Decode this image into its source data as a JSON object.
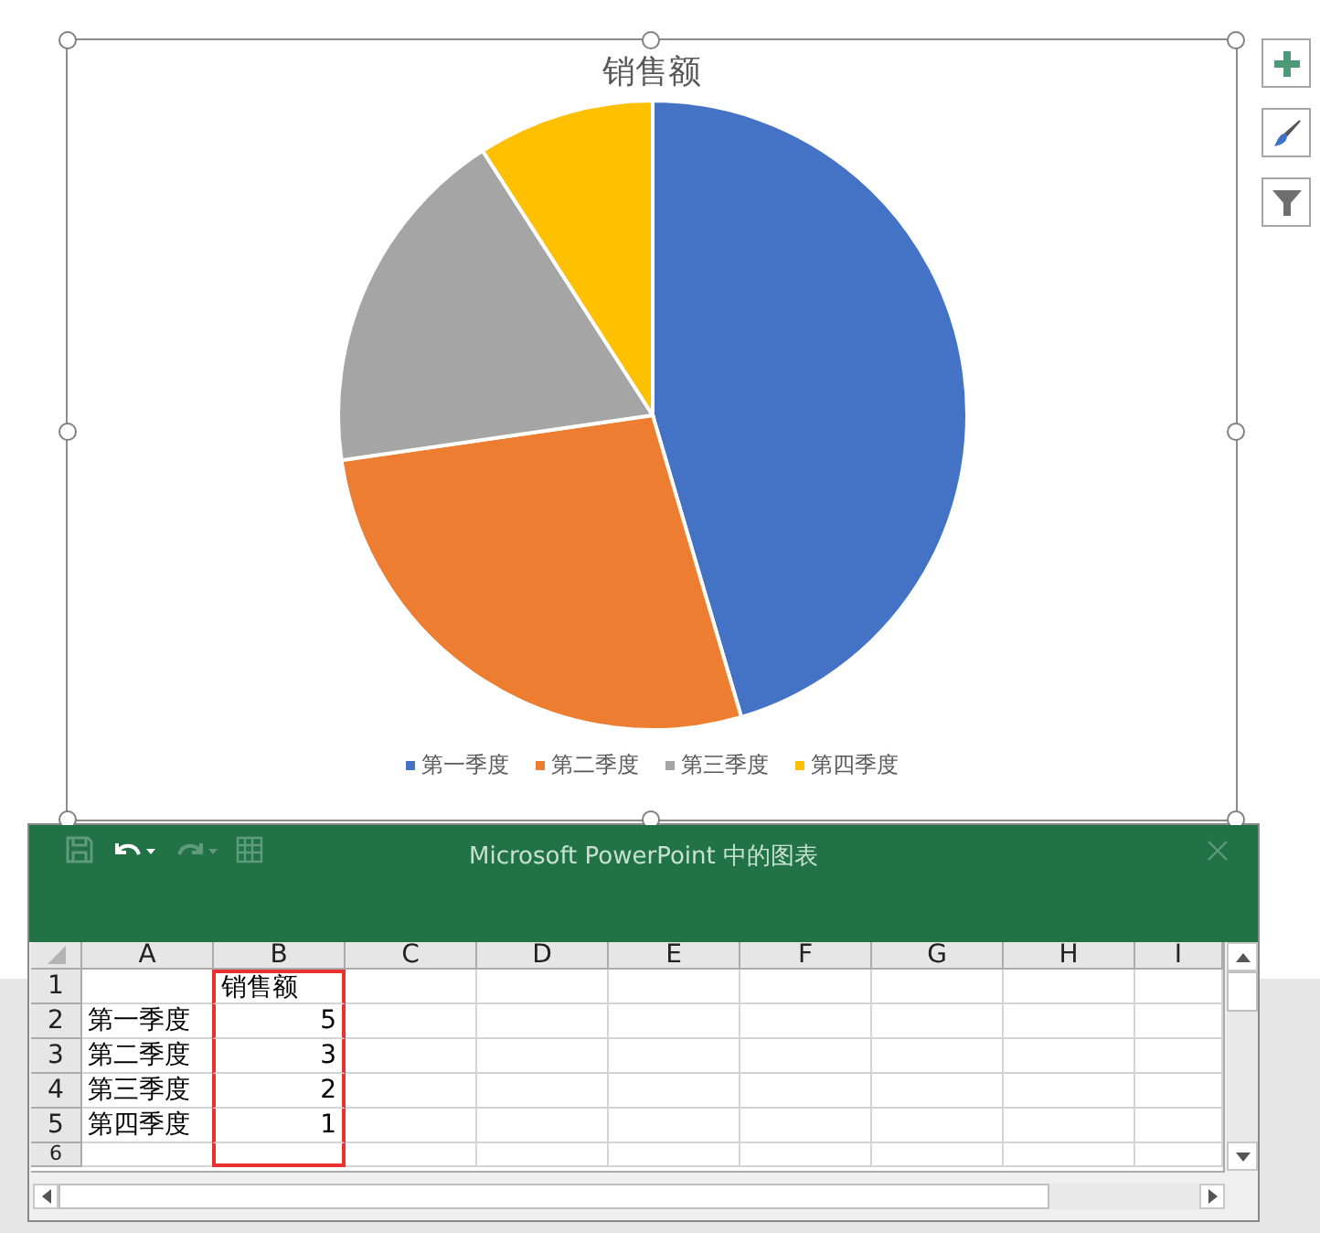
{
  "chart": {
    "chart_data": {
      "type": "pie",
      "title": "销售额",
      "categories": [
        "第一季度",
        "第二季度",
        "第三季度",
        "第四季度"
      ],
      "series": [
        {
          "values": [
            45.45,
            27.27,
            18.18,
            9.1
          ]
        }
      ],
      "colors": [
        "#4472c4",
        "#ed7d31",
        "#a5a5a5",
        "#ffc000"
      ]
    }
  },
  "chart_tools": [
    {
      "kind": "add"
    },
    {
      "kind": "style"
    },
    {
      "kind": "filter"
    }
  ],
  "sheet_window": {
    "title": "Microsoft PowerPoint 中的图表",
    "toolbar": [
      {
        "kind": "save",
        "disabled": true
      },
      {
        "kind": "undo",
        "disabled": false
      },
      {
        "kind": "redo",
        "disabled": true
      },
      {
        "kind": "table",
        "disabled": true
      }
    ],
    "columns": [
      {
        "label": "A",
        "outlined": false
      },
      {
        "label": "B",
        "outlined": true
      },
      {
        "label": "C",
        "outlined": false
      },
      {
        "label": "D",
        "outlined": false
      },
      {
        "label": "E",
        "outlined": false
      },
      {
        "label": "F",
        "outlined": false
      },
      {
        "label": "G",
        "outlined": false
      },
      {
        "label": "H",
        "outlined": false
      },
      {
        "label": "I",
        "outlined": false
      }
    ],
    "rows": [
      {
        "number": "1",
        "cells": [
          "",
          "销售额"
        ]
      },
      {
        "number": "2",
        "cells": [
          "第一季度",
          "5"
        ]
      },
      {
        "number": "3",
        "cells": [
          "第二季度",
          "3"
        ]
      },
      {
        "number": "4",
        "cells": [
          "第三季度",
          "2"
        ]
      },
      {
        "number": "5",
        "cells": [
          "第四季度",
          "1"
        ]
      },
      {
        "number": "6",
        "cells": []
      }
    ]
  }
}
